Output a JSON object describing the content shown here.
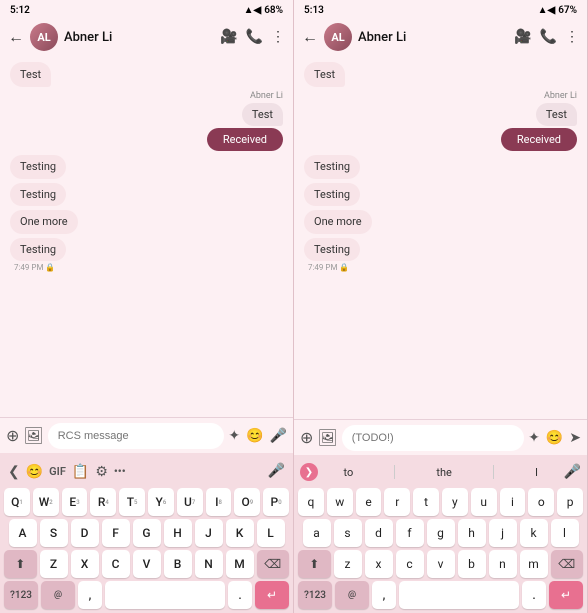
{
  "panels": [
    {
      "id": "panel-left",
      "status": {
        "time": "5:12",
        "signal": "▲",
        "wifi": "WiFi",
        "battery": "68%"
      },
      "header": {
        "back": "←",
        "contact": "Abner Li",
        "avatar_initials": "AL",
        "icons": [
          "video",
          "phone",
          "more"
        ]
      },
      "messages": [
        {
          "type": "sent",
          "text": "Test"
        },
        {
          "type": "received_label",
          "text": "Abner Li"
        },
        {
          "type": "received",
          "text": "Test"
        },
        {
          "type": "action",
          "text": "Received"
        },
        {
          "type": "small",
          "text": "Testing"
        },
        {
          "type": "small",
          "text": "Testing"
        },
        {
          "type": "small",
          "text": "One more"
        },
        {
          "type": "small",
          "text": "Testing"
        },
        {
          "type": "timestamp",
          "text": "7:49 PM 🔒"
        }
      ],
      "input": {
        "placeholder": "RCS message",
        "left_icons": [
          "+",
          "📷"
        ],
        "right_icons": [
          "✦",
          "😊",
          "🎤"
        ]
      },
      "keyboard": {
        "type": "standard",
        "toolbar": {
          "left": [
            "<",
            "😊",
            "GIF",
            "📋",
            "⚙",
            "•••",
            "🎤"
          ],
          "has_back": true
        },
        "rows": [
          [
            "Q",
            "W",
            "E",
            "R",
            "T",
            "Y",
            "U",
            "I",
            "O",
            "P"
          ],
          [
            "A",
            "S",
            "D",
            "F",
            "G",
            "H",
            "J",
            "K",
            "L"
          ],
          [
            "⬆",
            "Z",
            "X",
            "C",
            "V",
            "B",
            "N",
            "M",
            "⌫"
          ],
          [
            "?123",
            "@",
            ",",
            " ",
            ".",
            "↵"
          ]
        ]
      }
    },
    {
      "id": "panel-right",
      "status": {
        "time": "5:13",
        "signal": "▲",
        "wifi": "WiFi",
        "battery": "67%"
      },
      "header": {
        "back": "←",
        "contact": "Abner Li",
        "avatar_initials": "AL",
        "icons": [
          "video",
          "phone",
          "more"
        ]
      },
      "messages": [
        {
          "type": "sent",
          "text": "Test"
        },
        {
          "type": "received_label",
          "text": "Abner Li"
        },
        {
          "type": "received",
          "text": "Test"
        },
        {
          "type": "action",
          "text": "Received"
        },
        {
          "type": "small",
          "text": "Testing"
        },
        {
          "type": "small",
          "text": "Testing"
        },
        {
          "type": "small",
          "text": "One more"
        },
        {
          "type": "small",
          "text": "Testing"
        },
        {
          "type": "timestamp",
          "text": "7:49 PM 🔒"
        }
      ],
      "input": {
        "placeholder": "(TODO!)",
        "left_icons": [
          "+",
          "📷"
        ],
        "right_icons": [
          "✦",
          "😊",
          "➤"
        ]
      },
      "keyboard": {
        "type": "suggestion",
        "suggestions": [
          "to",
          "the",
          "I"
        ],
        "rows": [
          [
            "q",
            "w",
            "e",
            "r",
            "t",
            "y",
            "u",
            "i",
            "o",
            "p"
          ],
          [
            "a",
            "s",
            "d",
            "f",
            "g",
            "h",
            "j",
            "k",
            "l"
          ],
          [
            "⬆",
            "z",
            "x",
            "c",
            "v",
            "b",
            "n",
            "m",
            "⌫"
          ],
          [
            "?123",
            "@",
            ",",
            " ",
            ".",
            "↵"
          ]
        ]
      }
    }
  ]
}
